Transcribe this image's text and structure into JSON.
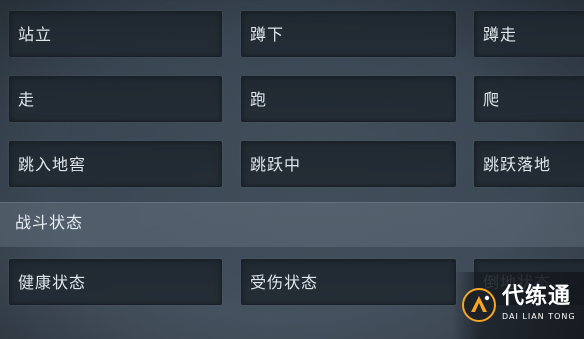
{
  "grid": {
    "row1": [
      "站立",
      "蹲下",
      "蹲走"
    ],
    "row2": [
      "走",
      "跑",
      "爬"
    ],
    "row3": [
      "跳入地窖",
      "跳跃中",
      "跳跃落地"
    ]
  },
  "section": {
    "title": "战斗状态"
  },
  "combat": [
    "健康状态",
    "受伤状态",
    "倒地状态"
  ],
  "watermark": {
    "brand": "代练通",
    "pinyin": "DAI LIAN TONG"
  },
  "colors": {
    "logo_accent": "#f5a623"
  }
}
